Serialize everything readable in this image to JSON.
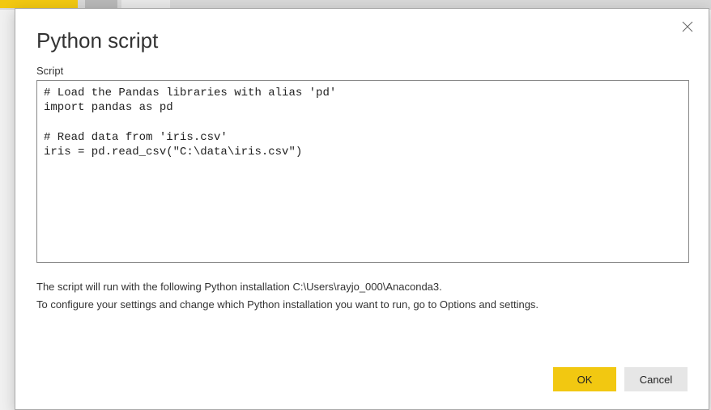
{
  "dialog": {
    "title": "Python script",
    "script_label": "Script",
    "script_content": "# Load the Pandas libraries with alias 'pd'\nimport pandas as pd\n\n# Read data from 'iris.csv'\niris = pd.read_csv(\"C:\\data\\iris.csv\")",
    "info_line1": "The script will run with the following Python installation C:\\Users\\rayjo_000\\Anaconda3.",
    "info_line2": "To configure your settings and change which Python installation you want to run, go to Options and settings.",
    "ok_label": "OK",
    "cancel_label": "Cancel"
  }
}
